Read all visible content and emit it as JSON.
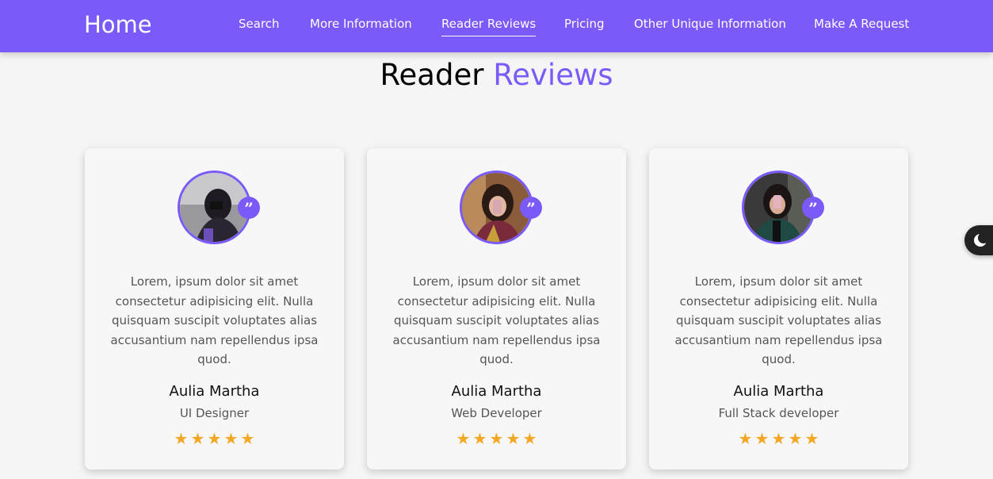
{
  "nav": {
    "brand": "Home",
    "links": [
      "Search",
      "More Information",
      "Reader Reviews",
      "Pricing",
      "Other Unique Information",
      "Make A Request"
    ],
    "active_index": 2
  },
  "section": {
    "title_plain": "Reader",
    "title_accent": "Reviews"
  },
  "reviews": [
    {
      "text": "Lorem, ipsum dolor sit amet consectetur adipisicing elit. Nulla quisquam suscipit voluptates alias accusantium nam repellendus ipsa quod.",
      "name": "Aulia Martha",
      "role": "UI Designer",
      "rating": 5
    },
    {
      "text": "Lorem, ipsum dolor sit amet consectetur adipisicing elit. Nulla quisquam suscipit voluptates alias accusantium nam repellendus ipsa quod.",
      "name": "Aulia Martha",
      "role": "Web Developer",
      "rating": 5
    },
    {
      "text": "Lorem, ipsum dolor sit amet consectetur adipisicing elit. Nulla quisquam suscipit voluptates alias accusantium nam repellendus ipsa quod.",
      "name": "Aulia Martha",
      "role": "Full Stack developer",
      "rating": 5
    }
  ],
  "icons": {
    "quote": "quote-icon",
    "star": "star-icon",
    "theme_toggle": "moon-icon"
  },
  "colors": {
    "accent": "#7a5af8",
    "star": "#f5a623",
    "background": "#f5f5f5"
  }
}
